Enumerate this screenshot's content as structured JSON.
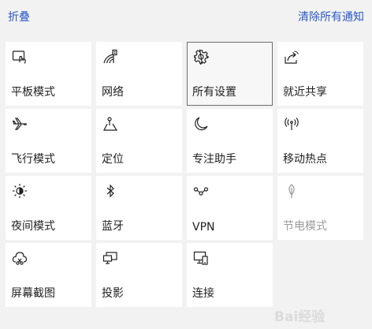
{
  "header": {
    "collapse_label": "折叠",
    "clear_all_label": "清除所有通知"
  },
  "tiles": [
    {
      "label": "平板模式",
      "icon": "tablet-mode-icon",
      "state": "normal"
    },
    {
      "label": "网络",
      "icon": "network-icon",
      "state": "normal"
    },
    {
      "label": "所有设置",
      "icon": "gear-icon",
      "state": "active"
    },
    {
      "label": "就近共享",
      "icon": "share-icon",
      "state": "normal"
    },
    {
      "label": "飞行模式",
      "icon": "airplane-icon",
      "state": "normal"
    },
    {
      "label": "定位",
      "icon": "location-icon",
      "state": "normal"
    },
    {
      "label": "专注助手",
      "icon": "moon-icon",
      "state": "normal"
    },
    {
      "label": "移动热点",
      "icon": "hotspot-icon",
      "state": "normal"
    },
    {
      "label": "夜间模式",
      "icon": "brightness-icon",
      "state": "normal"
    },
    {
      "label": "蓝牙",
      "icon": "bluetooth-icon",
      "state": "normal"
    },
    {
      "label": "VPN",
      "icon": "vpn-icon",
      "state": "normal"
    },
    {
      "label": "节电模式",
      "icon": "battery-saver-icon",
      "state": "disabled"
    },
    {
      "label": "屏幕截图",
      "icon": "screen-snip-icon",
      "state": "normal"
    },
    {
      "label": "投影",
      "icon": "project-icon",
      "state": "normal"
    },
    {
      "label": "连接",
      "icon": "connect-icon",
      "state": "normal"
    }
  ],
  "colors": {
    "link": "#2b58c8",
    "background": "#f2f2f2",
    "tile": "#ffffff",
    "disabled_text": "#9a9a9a"
  },
  "watermark": {
    "text": "Bai经验"
  }
}
